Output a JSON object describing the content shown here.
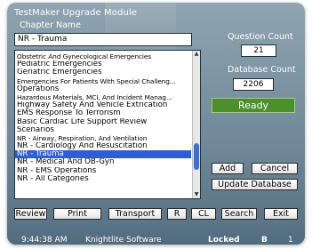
{
  "app": {
    "title": "TestMaker Upgrade Module"
  },
  "chapter": {
    "label": "Chapter Name",
    "value": "NR - Trauma"
  },
  "question_count": {
    "label": "Question Count",
    "value": "21"
  },
  "database_count": {
    "label": "Database Count",
    "value": "2206"
  },
  "status": {
    "ready_label": "Ready"
  },
  "chapters_list": {
    "items": [
      {
        "label": "Obstetric And Gynecological Emergencies",
        "small": true
      },
      {
        "label": "Pediatric Emergencies",
        "small": false
      },
      {
        "label": "Geriatric Emergencies",
        "small": false
      },
      {
        "label": "Emergencies For Patients With Special Challeng...",
        "small": true
      },
      {
        "label": "Operations",
        "small": false
      },
      {
        "label": "Hazardous Materials, MCI, And Incident Manag...",
        "small": true
      },
      {
        "label": "Highway Safety And Vehicle Extrication",
        "small": false
      },
      {
        "label": "EMS Response To Terrorism",
        "small": false
      },
      {
        "label": "Basic Cardiac Life Support Review",
        "small": false
      },
      {
        "label": "Scenarios",
        "small": false
      },
      {
        "label": "NR - Airway, Respiration, And Ventilation",
        "small": true
      },
      {
        "label": "NR - Cardiology And Resuscitation",
        "small": false
      },
      {
        "label": "NR - Trauma",
        "small": false,
        "selected": true
      },
      {
        "label": "NR - Medical And OB-Gyn",
        "small": false
      },
      {
        "label": "NR - EMS Operations",
        "small": false
      },
      {
        "label": "NR - All Categories",
        "small": false
      }
    ]
  },
  "side_buttons": {
    "add": "Add",
    "cancel": "Cancel",
    "update_database": "Update Database"
  },
  "toolbar": {
    "review": "Review",
    "print": "Print",
    "transport": "Transport",
    "r": "R",
    "cl": "CL",
    "search": "Search",
    "exit": "Exit"
  },
  "status_bar": {
    "time": "9:44:38 AM",
    "company": "Knightlite Software",
    "lock_state": "Locked",
    "mode": "B",
    "page": "1"
  },
  "colors": {
    "ready_green": "#4c8f2b",
    "selection_blue": "#2f5ed0"
  }
}
